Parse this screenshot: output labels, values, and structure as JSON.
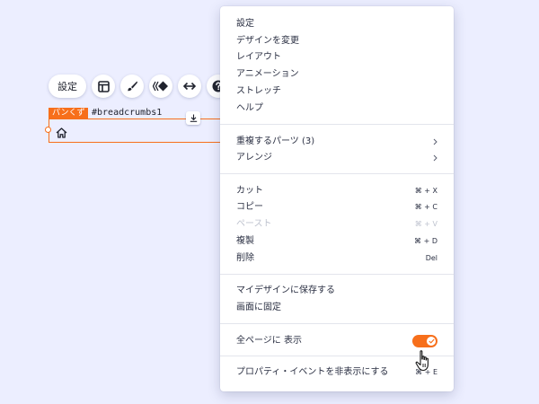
{
  "toolbar": {
    "settings_label": "設定",
    "buttons": [
      {
        "icon": "layout-icon"
      },
      {
        "icon": "brush-icon"
      },
      {
        "icon": "animation-icon"
      },
      {
        "icon": "stretch-icon"
      },
      {
        "icon": "help-icon"
      }
    ]
  },
  "component": {
    "tag": "パンくず",
    "id": "#breadcrumbs1"
  },
  "menu": {
    "group1": [
      "設定",
      "デザインを変更",
      "レイアウト",
      "アニメーション",
      "ストレッチ",
      "ヘルプ"
    ],
    "group2": [
      {
        "label": "重複するパーツ (3)"
      },
      {
        "label": "アレンジ"
      }
    ],
    "group3": [
      {
        "label": "カット",
        "shortcut": "⌘ + X",
        "disabled": false
      },
      {
        "label": "コピー",
        "shortcut": "⌘ + C",
        "disabled": false
      },
      {
        "label": "ペースト",
        "shortcut": "⌘ + V",
        "disabled": true
      },
      {
        "label": "複製",
        "shortcut": "⌘ + D",
        "disabled": false
      },
      {
        "label": "削除",
        "shortcut": "Del",
        "disabled": false
      }
    ],
    "group4": [
      "マイデザインに保存する",
      "画面に固定"
    ],
    "show_all_pages": {
      "label": "全ページに 表示",
      "enabled": true
    },
    "hide_props": {
      "label": "プロパティ・イベントを非表示にする",
      "shortcut": "⌘ + E"
    }
  },
  "colors": {
    "accent": "#f76f1b",
    "background": "#eceeff"
  }
}
